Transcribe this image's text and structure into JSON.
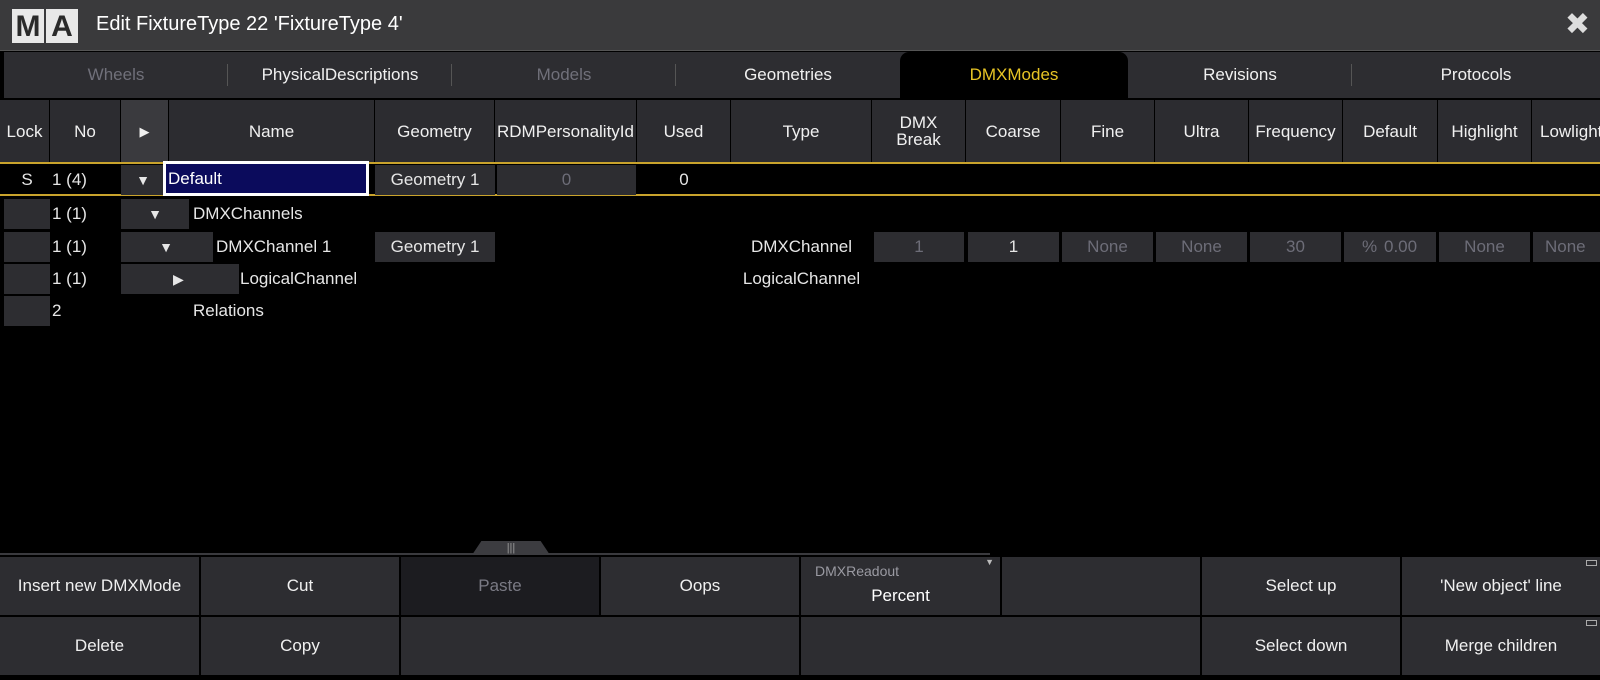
{
  "window": {
    "logo_m": "M",
    "logo_a": "A",
    "title": "Edit FixtureType 22 'FixtureType 4'",
    "close_glyph": "✖"
  },
  "tabs": [
    "Wheels",
    "PhysicalDescriptions",
    "Models",
    "Geometries",
    "DMXModes",
    "Revisions",
    "Protocols"
  ],
  "tab_states": {
    "active": "DMXModes",
    "disabled": [
      "Wheels",
      "Models"
    ]
  },
  "columns": {
    "lock": "Lock",
    "no": "No",
    "expand": "▶",
    "name": "Name",
    "geometry": "Geometry",
    "rdm": "RDMPersonalityId",
    "used": "Used",
    "type": "Type",
    "dmx_break_1": "DMX",
    "dmx_break_2": "Break",
    "coarse": "Coarse",
    "fine": "Fine",
    "ultra": "Ultra",
    "frequency": "Frequency",
    "default": "Default",
    "highlight": "Highlight",
    "lowlight": "Lowlight"
  },
  "rows": [
    {
      "lock": "S",
      "no": "1 (4)",
      "toggle": "▼",
      "name": "Default",
      "geometry": "Geometry 1",
      "rdm": "0",
      "used": "0"
    },
    {
      "no": "1 (1)",
      "toggle": "▼",
      "name": "DMXChannels"
    },
    {
      "no": "1 (1)",
      "toggle": "▼",
      "name": "DMXChannel 1",
      "geometry": "Geometry 1",
      "type": "DMXChannel",
      "dmx_break": "1",
      "coarse": "1",
      "fine": "None",
      "ultra": "None",
      "frequency": "30",
      "default_unit": "%",
      "default_value": "0.00",
      "highlight": "None",
      "lowlight": "None"
    },
    {
      "no": "1 (1)",
      "toggle": "▶",
      "name": "LogicalChannel",
      "type": "LogicalChannel"
    },
    {
      "no": "2",
      "name": "Relations"
    }
  ],
  "divider_handle": "|||",
  "buttons": {
    "insert": "Insert new DMXMode",
    "cut": "Cut",
    "paste": "Paste",
    "oops": "Oops",
    "dmx_readout_label": "DMXReadout",
    "dmx_readout_value": "Percent",
    "dmx_readout_arrow": "▼",
    "select_up": "Select up",
    "new_object_line": "'New object' line",
    "delete": "Delete",
    "copy": "Copy",
    "select_down": "Select down",
    "merge_children": "Merge children"
  },
  "colors": {
    "accent": "#e7c425",
    "row_highlight": "#c9a32c",
    "edit_bg": "#0b0b5c",
    "panel": "#2d2d31"
  }
}
